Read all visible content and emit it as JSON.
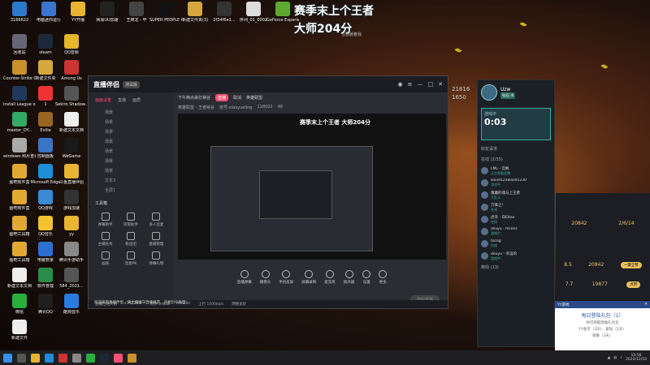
{
  "colors": {
    "accent": "#ff4e72",
    "panel": "#23252b",
    "teal": "#2b6b5a"
  },
  "overlay": {
    "line1": "赛季末上个王者",
    "line2": "大师204分",
    "sub": "也要缓着我"
  },
  "desktop_icons": [
    {
      "label": "3166622",
      "icon": "user-icon",
      "color": "#2b7ac9"
    },
    {
      "label": "电脑迷你运行",
      "icon": "app-icon",
      "color": "#3a75d0"
    },
    {
      "label": "YY开播",
      "icon": "yy-icon",
      "color": "#e8b431"
    },
    {
      "label": "网易UU加速",
      "icon": "uu-icon",
      "color": "#222"
    },
    {
      "label": "王牌龙 - 毕",
      "icon": "game-icon",
      "color": "#444"
    },
    {
      "label": "SUPER PEOPLE CBT",
      "icon": "game-icon",
      "color": "#111"
    },
    {
      "label": "新建文件夹(3)",
      "icon": "folder-icon",
      "color": "#d6a73c"
    },
    {
      "label": "2f34f6e1...",
      "icon": "file-icon",
      "color": "#333"
    },
    {
      "label": "序列_01_0002",
      "icon": "file-icon",
      "color": "#ddd"
    },
    {
      "label": "GeForce Experience",
      "icon": "nvidia-icon",
      "color": "#5fa82f"
    },
    {
      "label": "回收站",
      "icon": "recycle-bin-icon",
      "color": "#667"
    },
    {
      "label": "steam",
      "icon": "steam-icon",
      "color": "#1b2838"
    },
    {
      "label": "QQ音频",
      "icon": "qq-music-icon",
      "color": "#e3b62c"
    },
    {
      "label": "Counter-Strike Global Off...",
      "icon": "csgo-icon",
      "color": "#c9922c"
    },
    {
      "label": "新建文件夹",
      "icon": "folder-icon",
      "color": "#d6a73c"
    },
    {
      "label": "Among Us",
      "icon": "among-us-icon",
      "color": "#c33"
    },
    {
      "label": "Install League o...",
      "icon": "lol-icon",
      "color": "#21395a"
    },
    {
      "label": "1",
      "icon": "file-icon",
      "color": "#e33"
    },
    {
      "label": "Sekiro Shadow...",
      "icon": "sekiro-icon",
      "color": "#555"
    },
    {
      "label": "master_DY...",
      "icon": "file-icon",
      "color": "#3a6"
    },
    {
      "label": "Eville",
      "icon": "game-icon",
      "color": "#962"
    },
    {
      "label": "新建文本文档",
      "icon": "file-icon",
      "color": "#eee"
    },
    {
      "label": "windows 照片查看器",
      "icon": "photo-icon",
      "color": "#aaa"
    },
    {
      "label": "控制面板",
      "icon": "control-panel-icon",
      "color": "#3a74c4"
    },
    {
      "label": "WeGame",
      "icon": "wegame-icon",
      "color": "#1a1a1a"
    },
    {
      "label": "图吧软件盒",
      "icon": "app-icon",
      "color": "#e1a932"
    },
    {
      "label": "Microsoft Edge",
      "icon": "edge-icon",
      "color": "#1e8ed6"
    },
    {
      "label": "斗鱼直播伴侣",
      "icon": "douyu-icon",
      "color": "#e8b431"
    },
    {
      "label": "图吧软件盒",
      "icon": "app-icon",
      "color": "#e1a932"
    },
    {
      "label": "QQ游戏",
      "icon": "qq-game-icon",
      "color": "#3a8ad6"
    },
    {
      "label": "游戏加速",
      "icon": "app-icon",
      "color": "#333"
    },
    {
      "label": "图吧工具箱",
      "icon": "app-icon",
      "color": "#e1a932"
    },
    {
      "label": "QQ音乐",
      "icon": "qq-music-icon",
      "color": "#f2c430"
    },
    {
      "label": "yy",
      "icon": "yy-icon",
      "color": "#e8b431"
    },
    {
      "label": "图吧工具箱",
      "icon": "app-icon",
      "color": "#e1a932"
    },
    {
      "label": "电脑管家",
      "icon": "shield-icon",
      "color": "#2c6fd0"
    },
    {
      "label": "腾讯手游助手",
      "icon": "app-icon",
      "color": "#888"
    },
    {
      "label": "新建文本文档",
      "icon": "file-icon",
      "color": "#eee"
    },
    {
      "label": "软件管理",
      "icon": "app-icon",
      "color": "#2a8e4a"
    },
    {
      "label": "584_2021...",
      "icon": "file-icon",
      "color": "#555"
    },
    {
      "label": "微信",
      "icon": "wechat-icon",
      "color": "#2aae3c"
    },
    {
      "label": "腾讯QQ",
      "icon": "qq-icon",
      "color": "#1f1f1f"
    },
    {
      "label": "酷狗音乐",
      "icon": "kugou-icon",
      "color": "#2a7be0"
    },
    {
      "label": "新建文件",
      "icon": "file-icon",
      "color": "#eee"
    }
  ],
  "app": {
    "logo": "直播伴侣",
    "version": "测试版",
    "left_tabs": [
      "画面设置",
      "直播",
      "画质"
    ],
    "scenes": [
      "场景",
      "场景",
      "场景",
      "场景",
      "场景",
      "场景",
      "场景",
      "文本3",
      "全屏1"
    ],
    "tools_title": "工具箱",
    "tools": [
      "弹幕助手",
      "房管助手",
      "多人连麦",
      "主播任务",
      "粉丝团",
      "直播管理",
      "画质",
      "连麦PK",
      "弹幕礼物"
    ],
    "head": {
      "title": "下午两点来打峡谷",
      "live": "直播",
      "opt1": "取消",
      "opt2": "英雄联盟"
    },
    "head2": {
      "cat": "英雄联盟 - 王者峡谷",
      "id": "房号:xiaoyueling",
      "num": "118022",
      "viewers": "48"
    },
    "preview_title": "赛季末上个王者 大师204分",
    "bar": [
      "直播弹幕",
      "摄像头",
      "手机投屏",
      "屏幕录制",
      "麦克风",
      "扬声器",
      "设置",
      "更多"
    ],
    "go_live": "开始直播",
    "status": [
      "直播已经开始",
      "CPU 20%",
      "内存 5.6GB",
      "FPS 60",
      "上行 1500kb/s",
      "网络良好"
    ]
  },
  "notice": "欢迎来到直播伴侣，请主播遵守直播规范，违者封号处理",
  "panel": {
    "name": "Uzw",
    "badge": "钻石 III",
    "timer_title": "游戏中",
    "timer": "0:03",
    "section": "好友请求",
    "group": "在线 (2/35)",
    "friends": [
      {
        "name": "LML - 云枫",
        "status": "正在观看直播"
      },
      {
        "name": "wavd123wavd1230",
        "status": "游戏中"
      },
      {
        "name": "傀儡的魂与上王者",
        "status": "大乱斗"
      },
      {
        "name": "刀锋之!",
        "status": "在线"
      },
      {
        "name": "虎牙 - 白Eltao",
        "status": "在线"
      },
      {
        "name": "dsuyu - msons",
        "status": "游戏中"
      },
      {
        "name": "tocog",
        "status": "在线"
      },
      {
        "name": "douyu - 幸运的",
        "status": "游戏中"
      }
    ],
    "footer": "离线 (13)"
  },
  "score": {
    "a": "20842",
    "b": "2/6/14",
    "c": "8.5",
    "d": "20842",
    "btn1": "一键全赞",
    "e": "7.7",
    "f": "19877",
    "btn2": "点赞"
  },
  "notif": {
    "app": "YY游戏",
    "title": "每日登陆礼包（1）",
    "l1": "你可领取登陆礼包包",
    "l2": "YY金币（3天）、紫钻（2天）",
    "l3": "荣耀（3天）"
  },
  "clock": {
    "time": "13:56",
    "date": "2022/12/18"
  },
  "top": {
    "n1": "21816",
    "n2": "1650"
  }
}
